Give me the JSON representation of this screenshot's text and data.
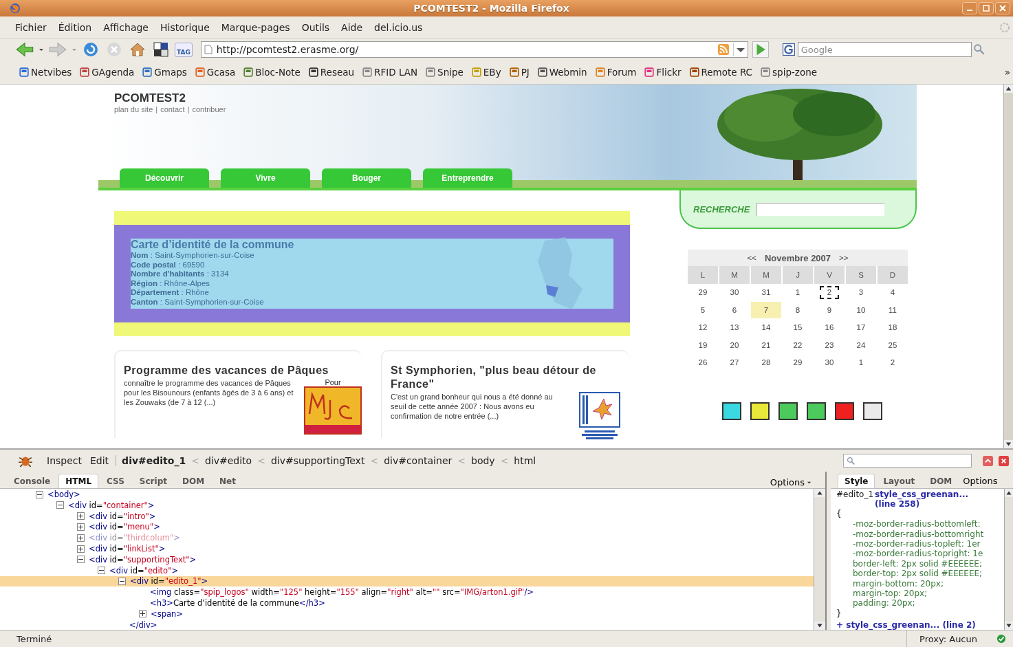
{
  "window": {
    "title": "PCOMTEST2 - Mozilla Firefox"
  },
  "menu": [
    "Fichier",
    "Édition",
    "Affichage",
    "Historique",
    "Marque-pages",
    "Outils",
    "Aide",
    "del.icio.us"
  ],
  "navigation": {
    "tag_label": "TAG",
    "url": "http://pcomtest2.erasme.org/",
    "search_placeholder": "Google"
  },
  "bookmarks": {
    "items": [
      "Netvibes",
      "GAgenda",
      "Gmaps",
      "Gcasa",
      "Bloc-Note",
      "Reseau",
      "RFID LAN",
      "Snipe",
      "EBy",
      "PJ",
      "Webmin",
      "Forum",
      "Flickr",
      "Remote RC",
      "spip-zone"
    ],
    "overflow": "»"
  },
  "page": {
    "site_title": "PCOMTEST2",
    "site_links": [
      "plan du site",
      "contact",
      "contribuer"
    ],
    "link_separator": "|",
    "nav": [
      "Découvrir",
      "Vivre",
      "Bouger",
      "Entreprendre"
    ],
    "search": {
      "label": "RECHERCHE"
    },
    "identity": {
      "title": "Carte d’identité de la commune",
      "lines": [
        "**Nom** : Saint-Symphorien-sur-Coise",
        "**Code postal** : 69590",
        "**Nombre d'habitants** : 3134",
        "**Région** : Rhône-Alpes",
        "**Département** : Rhône",
        "**Canton** : Saint-Symphorien-sur-Coise"
      ]
    },
    "articles": [
      {
        "kind": "mjc",
        "title": "Programme des vacances de Pâques",
        "caption": "Pour",
        "text": "connaître le programme des vacances de Pâques pour les Bisounours (enfants âgés de 3 à 6 ans) et les Zouwaks (de 7 à 12 (...)"
      },
      {
        "kind": "detours",
        "title": "St Symphorien, \"plus beau détour de France\"",
        "text": "C'est un grand bonheur qui nous a été donné au seuil de cette année 2007 : Nous avons eu confirmation de notre entrée (...)"
      }
    ],
    "calendar": {
      "prev": "<<",
      "month": "Novembre 2007",
      "next": ">>",
      "weekdays": [
        "L",
        "M",
        "M",
        "J",
        "V",
        "S",
        "D"
      ],
      "weeks": [
        [
          {
            "day": "29",
            "today": false,
            "focused": false
          },
          {
            "day": "30",
            "today": false,
            "focused": false
          },
          {
            "day": "31",
            "today": false,
            "focused": false
          },
          {
            "day": "1",
            "today": false,
            "focused": false
          },
          {
            "day": "2",
            "today": false,
            "focused": true
          },
          {
            "day": "3",
            "today": false,
            "focused": false
          },
          {
            "day": "4",
            "today": false,
            "focused": false
          }
        ],
        [
          {
            "day": "5",
            "today": false,
            "focused": false
          },
          {
            "day": "6",
            "today": false,
            "focused": false
          },
          {
            "day": "7",
            "today": true,
            "focused": false
          },
          {
            "day": "8",
            "today": false,
            "focused": false
          },
          {
            "day": "9",
            "today": false,
            "focused": false
          },
          {
            "day": "10",
            "today": false,
            "focused": false
          },
          {
            "day": "11",
            "today": false,
            "focused": false
          }
        ],
        [
          {
            "day": "12",
            "today": false,
            "focused": false
          },
          {
            "day": "13",
            "today": false,
            "focused": false
          },
          {
            "day": "14",
            "today": false,
            "focused": false
          },
          {
            "day": "15",
            "today": false,
            "focused": false
          },
          {
            "day": "16",
            "today": false,
            "focused": false
          },
          {
            "day": "17",
            "today": false,
            "focused": false
          },
          {
            "day": "18",
            "today": false,
            "focused": false
          }
        ],
        [
          {
            "day": "19",
            "today": false,
            "focused": false
          },
          {
            "day": "20",
            "today": false,
            "focused": false
          },
          {
            "day": "21",
            "today": false,
            "focused": false
          },
          {
            "day": "22",
            "today": false,
            "focused": false
          },
          {
            "day": "23",
            "today": false,
            "focused": false
          },
          {
            "day": "24",
            "today": false,
            "focused": false
          },
          {
            "day": "25",
            "today": false,
            "focused": false
          }
        ],
        [
          {
            "day": "26",
            "today": false,
            "focused": false
          },
          {
            "day": "27",
            "today": false,
            "focused": false
          },
          {
            "day": "28",
            "today": false,
            "focused": false
          },
          {
            "day": "29",
            "today": false,
            "focused": false
          },
          {
            "day": "30",
            "today": false,
            "focused": false
          },
          {
            "day": "1",
            "today": false,
            "focused": false
          },
          {
            "day": "2",
            "today": false,
            "focused": false
          }
        ]
      ]
    },
    "swatches": [
      {
        "color": "#3ad8e0"
      },
      {
        "color": "#e8e83a"
      },
      {
        "color": "#4cca5c"
      },
      {
        "color": "#4cca5c"
      },
      {
        "color": "#f02020"
      },
      {
        "color": "#eaeaea"
      }
    ]
  },
  "firebug": {
    "tools": [
      "Inspect",
      "Edit"
    ],
    "breadcrumbs": [
      {
        "label": "div#edito_1",
        "selected": true
      },
      {
        "label": "div#edito",
        "selected": false
      },
      {
        "label": "div#supportingText",
        "selected": false
      },
      {
        "label": "div#container",
        "selected": false
      },
      {
        "label": "body",
        "selected": false
      },
      {
        "label": "html",
        "selected": false
      }
    ],
    "crumb_separator": "<",
    "tabs": [
      {
        "label": "Console",
        "selected": false
      },
      {
        "label": "HTML",
        "selected": true
      },
      {
        "label": "CSS",
        "selected": false
      },
      {
        "label": "Script",
        "selected": false
      },
      {
        "label": "DOM",
        "selected": false
      },
      {
        "label": "Net",
        "selected": false
      }
    ],
    "options": "Options",
    "html_tree": [
      {
        "text": "<body>",
        "expanded": true,
        "selected": false,
        "dimmed": false,
        "children": [
          {
            "text": "<div id=\"container\">",
            "expanded": true,
            "selected": false,
            "dimmed": false,
            "children": [
              {
                "text": "<div id=\"intro\">",
                "expanded": false,
                "selected": false,
                "dimmed": false
              },
              {
                "text": "<div id=\"menu\">",
                "expanded": false,
                "selected": false,
                "dimmed": false
              },
              {
                "text": "<div id=\"thirdcolum\">",
                "expanded": false,
                "selected": false,
                "dimmed": true
              },
              {
                "text": "<div id=\"linkList\">",
                "expanded": false,
                "selected": false,
                "dimmed": false
              },
              {
                "text": "<div id=\"supportingText\">",
                "expanded": true,
                "selected": false,
                "dimmed": false,
                "children": [
                  {
                    "text": "<div id=\"edito\">",
                    "expanded": true,
                    "selected": false,
                    "dimmed": false,
                    "children": [
                      {
                        "text": "<div id=\"edito_1\">",
                        "expanded": true,
                        "selected": true,
                        "dimmed": false,
                        "children": [
                          {
                            "text": "<img class=\"spip_logos\" width=\"125\" height=\"155\" align=\"right\" alt=\"\" src=\"IMG/arton1.gif\"/>",
                            "selected": false,
                            "dimmed": false
                          },
                          {
                            "text": "<h3>Carte d’identité de la commune</h3>",
                            "selected": false,
                            "dimmed": false
                          },
                          {
                            "text": "<span>",
                            "expanded": false,
                            "selected": false,
                            "dimmed": false
                          }
                        ]
                      },
                      {
                        "text": "</div>",
                        "selected": false,
                        "dimmed": false
                      }
                    ]
                  }
                ]
              }
            ]
          }
        ]
      }
    ],
    "side_tabs": [
      {
        "label": "Style",
        "selected": true
      },
      {
        "label": "Layout",
        "selected": false
      },
      {
        "label": "DOM",
        "selected": false
      }
    ],
    "side_options": "Options",
    "style_rule": {
      "selector": "#edito_1",
      "source": "style_css_greenan... (line 258)",
      "open": "{",
      "close": "}",
      "properties": [
        "-moz-border-radius-bottomleft:",
        "-moz-border-radius-bottomright",
        "-moz-border-radius-topleft: 1er",
        "-moz-border-radius-topright: 1e",
        "border-left: 2px solid #EEEEEE;",
        "border-top: 2px solid #EEEEEE;",
        "margin-bottom: 20px;",
        "margin-top: 20px;",
        "padding: 20px;"
      ]
    },
    "next_rule": "+ style_css_greenan... (line 2)"
  },
  "status_bar": {
    "text": "Terminé",
    "proxy": "Proxy: Aucun"
  }
}
